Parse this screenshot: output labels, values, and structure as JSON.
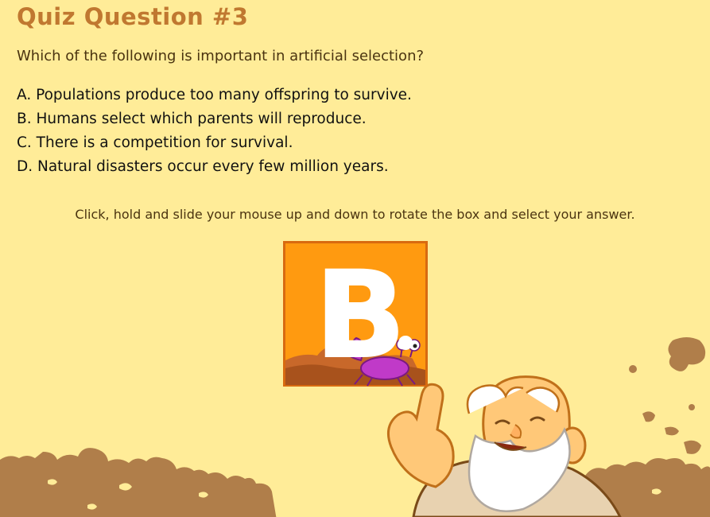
{
  "quiz": {
    "title": "Quiz Question #3",
    "question": "Which of the following is important in artificial selection?",
    "options": [
      "A. Populations produce too many offspring to survive.",
      "B. Humans select which parents will reproduce.",
      "C. There is a competition for survival.",
      "D. Natural disasters occur every few million years."
    ],
    "instruction": "Click, hold and slide your mouse up and down to rotate the box and select your answer."
  },
  "answer_box": {
    "selected_letter": "B",
    "color": "#FF9A10",
    "border_color": "#D86A10"
  },
  "colors": {
    "background": "#FFEC98",
    "title": "#C07830",
    "ground": "#B07E4A",
    "crab": "#C03AC8"
  },
  "scene": {
    "mascot": "old-bearded-man-pointing",
    "creature": "purple-crab"
  }
}
